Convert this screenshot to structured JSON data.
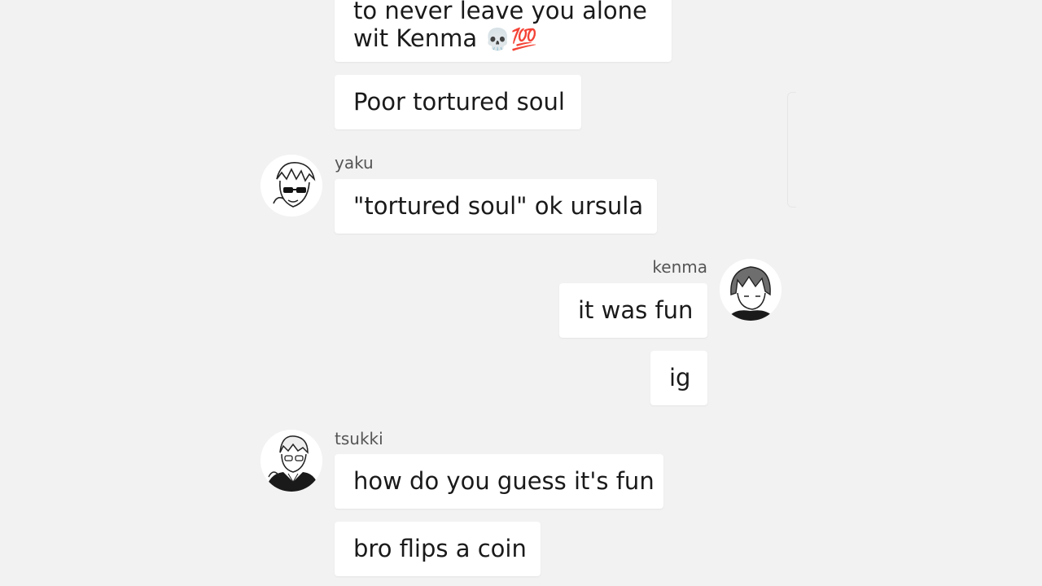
{
  "messages": [
    {
      "sender": "",
      "lines": [
        "to never leave you alone",
        "wit Kenma"
      ],
      "emoji": "💀",
      "emoji_2": "💯"
    },
    {
      "sender": "",
      "text": "Poor tortured soul"
    },
    {
      "sender": "yaku",
      "text": "\"tortured soul\" ok ursula"
    },
    {
      "sender": "kenma",
      "text": "it was fun"
    },
    {
      "sender": "",
      "text": "ig"
    },
    {
      "sender": "tsukki",
      "text": "how do you guess it's fun"
    },
    {
      "sender": "",
      "text": "bro flips a coin"
    }
  ],
  "avatars": {
    "yaku": "yaku-avatar",
    "kenma": "kenma-avatar",
    "tsukki": "tsukki-avatar"
  },
  "colors": {
    "background": "#f2f2f2",
    "bubble": "#ffffff",
    "username": "#555555"
  }
}
